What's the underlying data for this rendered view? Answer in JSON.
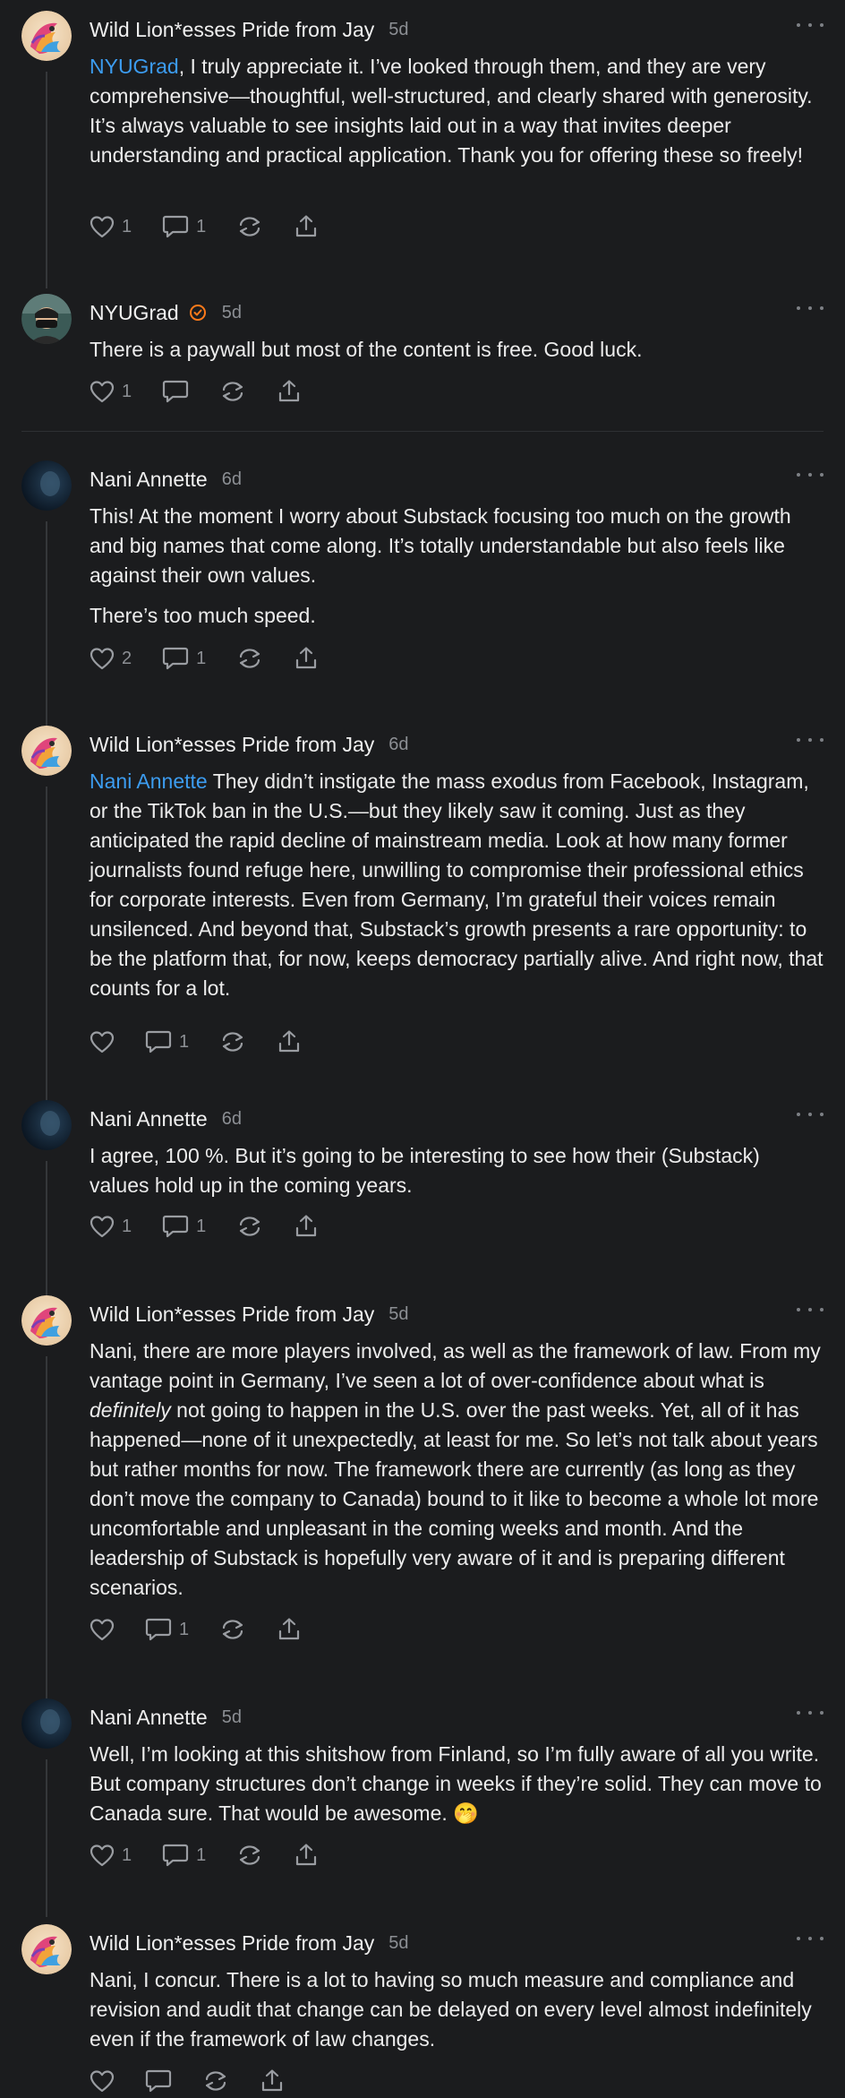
{
  "comments": [
    {
      "author": "Wild Lion*esses Pride from Jay",
      "time": "5d",
      "mention": "NYUGrad",
      "text": ", I truly appreciate it. I’ve looked through them, and they are very comprehensive—thoughtful, well-structured, and clearly shared with generosity. It’s always valuable to see insights laid out in a way that invites deeper understanding and practical application. Thank you for offering these so freely!",
      "likes": "1",
      "replies": "1"
    },
    {
      "author": "NYUGrad",
      "time": "5d",
      "text": "There is a paywall but most of the content is free. Good luck.",
      "likes": "1",
      "replies": ""
    },
    {
      "author": "Nani Annette",
      "time": "6d",
      "text": "This! At the moment I worry about Substack focusing too much on the growth and big names that come along. It’s totally understandable but also feels like against their own values.",
      "text2": "There’s too much speed.",
      "likes": "2",
      "replies": "1"
    },
    {
      "author": "Wild Lion*esses Pride from Jay",
      "time": "6d",
      "mention": "Nani Annette",
      "text": " They didn’t instigate the mass exodus from Facebook, Instagram, or the TikTok ban in the U.S.—but they likely saw it coming. Just as they anticipated the rapid decline of mainstream media. Look at how many former journalists found refuge here, unwilling to compromise their professional ethics for corporate interests. Even from Germany, I’m grateful their voices remain unsilenced. And beyond that, Substack’s growth presents a rare opportunity: to be the platform that, for now, keeps democracy partially alive. And right now, that counts for a lot.",
      "likes": "",
      "replies": "1"
    },
    {
      "author": "Nani Annette",
      "time": "6d",
      "text": "I agree, 100 %. But it’s going to be interesting to see how their (Substack) values hold up in the coming years.",
      "likes": "1",
      "replies": "1"
    },
    {
      "author": "Wild Lion*esses Pride from Jay",
      "time": "5d",
      "text_a": "Nani, there are more players involved, as well as the framework of law. From my vantage point in Germany, I’ve seen a lot of over-confidence about what is ",
      "text_em": "definitely",
      "text_b": " not going to happen in the U.S. over the past weeks. Yet, all of it has happened—none of it unexpectedly, at least for me. So let’s not talk about years but rather months for now. The framework there are currently (as long as they don’t move the company to Canada) bound to it like to become a whole lot more uncomfortable and unpleasant in the coming weeks and month. And the leadership of Substack is hopefully very aware of it and is preparing different scenarios.",
      "likes": "",
      "replies": "1"
    },
    {
      "author": "Nani Annette",
      "time": "5d",
      "text": "Well, I’m looking at this shitshow from Finland, so I’m fully aware of all you write. But company structures don’t change in weeks if they’re solid. They can move to Canada sure. That would be awesome. 🤭",
      "likes": "1",
      "replies": "1"
    },
    {
      "author": "Wild Lion*esses Pride from Jay",
      "time": "5d",
      "text": "Nani, I concur. There is a lot to having so much measure and compliance and revision and audit that change can be delayed on every level almost indefinitely even if the framework of law changes.",
      "likes": "",
      "replies": ""
    }
  ],
  "icons": {
    "like": "heart-icon",
    "reply": "comment-bubble-icon",
    "restack": "restack-icon",
    "share": "share-icon",
    "more": "more-dots-icon",
    "verified": "verified-badge-icon"
  },
  "colors": {
    "background": "#1b1c1e",
    "mention": "#3c9cf0",
    "verified": "#ff7a1a",
    "muted": "#8c8f94"
  }
}
